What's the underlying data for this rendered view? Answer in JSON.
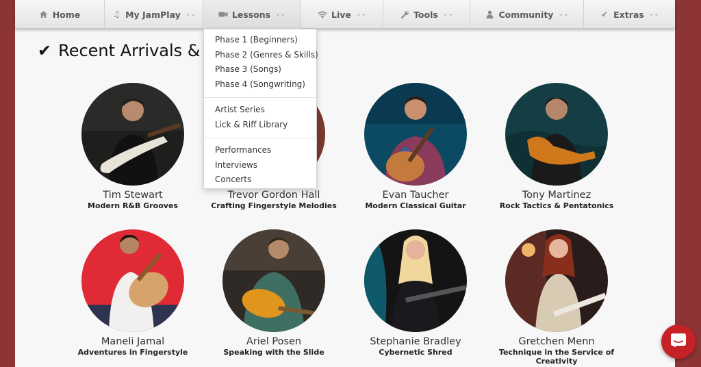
{
  "nav": {
    "items": [
      {
        "label": "Home",
        "icon": "home-icon",
        "has_caret": false
      },
      {
        "label": "My JamPlay",
        "icon": "music-note-icon",
        "has_caret": true
      },
      {
        "label": "Lessons",
        "icon": "video-camera-icon",
        "has_caret": true
      },
      {
        "label": "Live",
        "icon": "wifi-icon",
        "has_caret": true
      },
      {
        "label": "Tools",
        "icon": "wrench-icon",
        "has_caret": true
      },
      {
        "label": "Community",
        "icon": "user-icon",
        "has_caret": true
      },
      {
        "label": "Extras",
        "icon": "check-icon",
        "has_caret": true
      }
    ],
    "caret_glyph": "⌄⌄"
  },
  "section": {
    "title": "Recent Arrivals & N",
    "icon": "checkmark-icon"
  },
  "lessons_menu": {
    "groups": [
      [
        "Phase 1 (Beginners)",
        "Phase 2 (Genres & Skills)",
        "Phase 3 (Songs)",
        "Phase 4 (Songwriting)"
      ],
      [
        "Artist Series",
        "Lick & Riff Library"
      ],
      [
        "Performances",
        "Interviews",
        "Concerts"
      ]
    ]
  },
  "artists": [
    {
      "name": "Tim Stewart",
      "course": "Modern R&B Grooves"
    },
    {
      "name": "Trevor Gordon Hall",
      "course": "Crafting Fingerstyle Melodies"
    },
    {
      "name": "Evan Taucher",
      "course": "Modern Classical Guitar"
    },
    {
      "name": "Tony Martinez",
      "course": "Rock Tactics & Pentatonics"
    },
    {
      "name": "Maneli Jamal",
      "course": "Adventures in Fingerstyle"
    },
    {
      "name": "Ariel Posen",
      "course": "Speaking with the Slide"
    },
    {
      "name": "Stephanie Bradley",
      "course": "Cybernetic Shred"
    },
    {
      "name": "Gretchen Menn",
      "course": "Technique in the Service of Creativity"
    }
  ],
  "chat": {
    "icon": "chat-icon"
  },
  "colors": {
    "brand_red": "#c62126",
    "background": "#8c3436",
    "nav_text": "#5a5a5a"
  }
}
